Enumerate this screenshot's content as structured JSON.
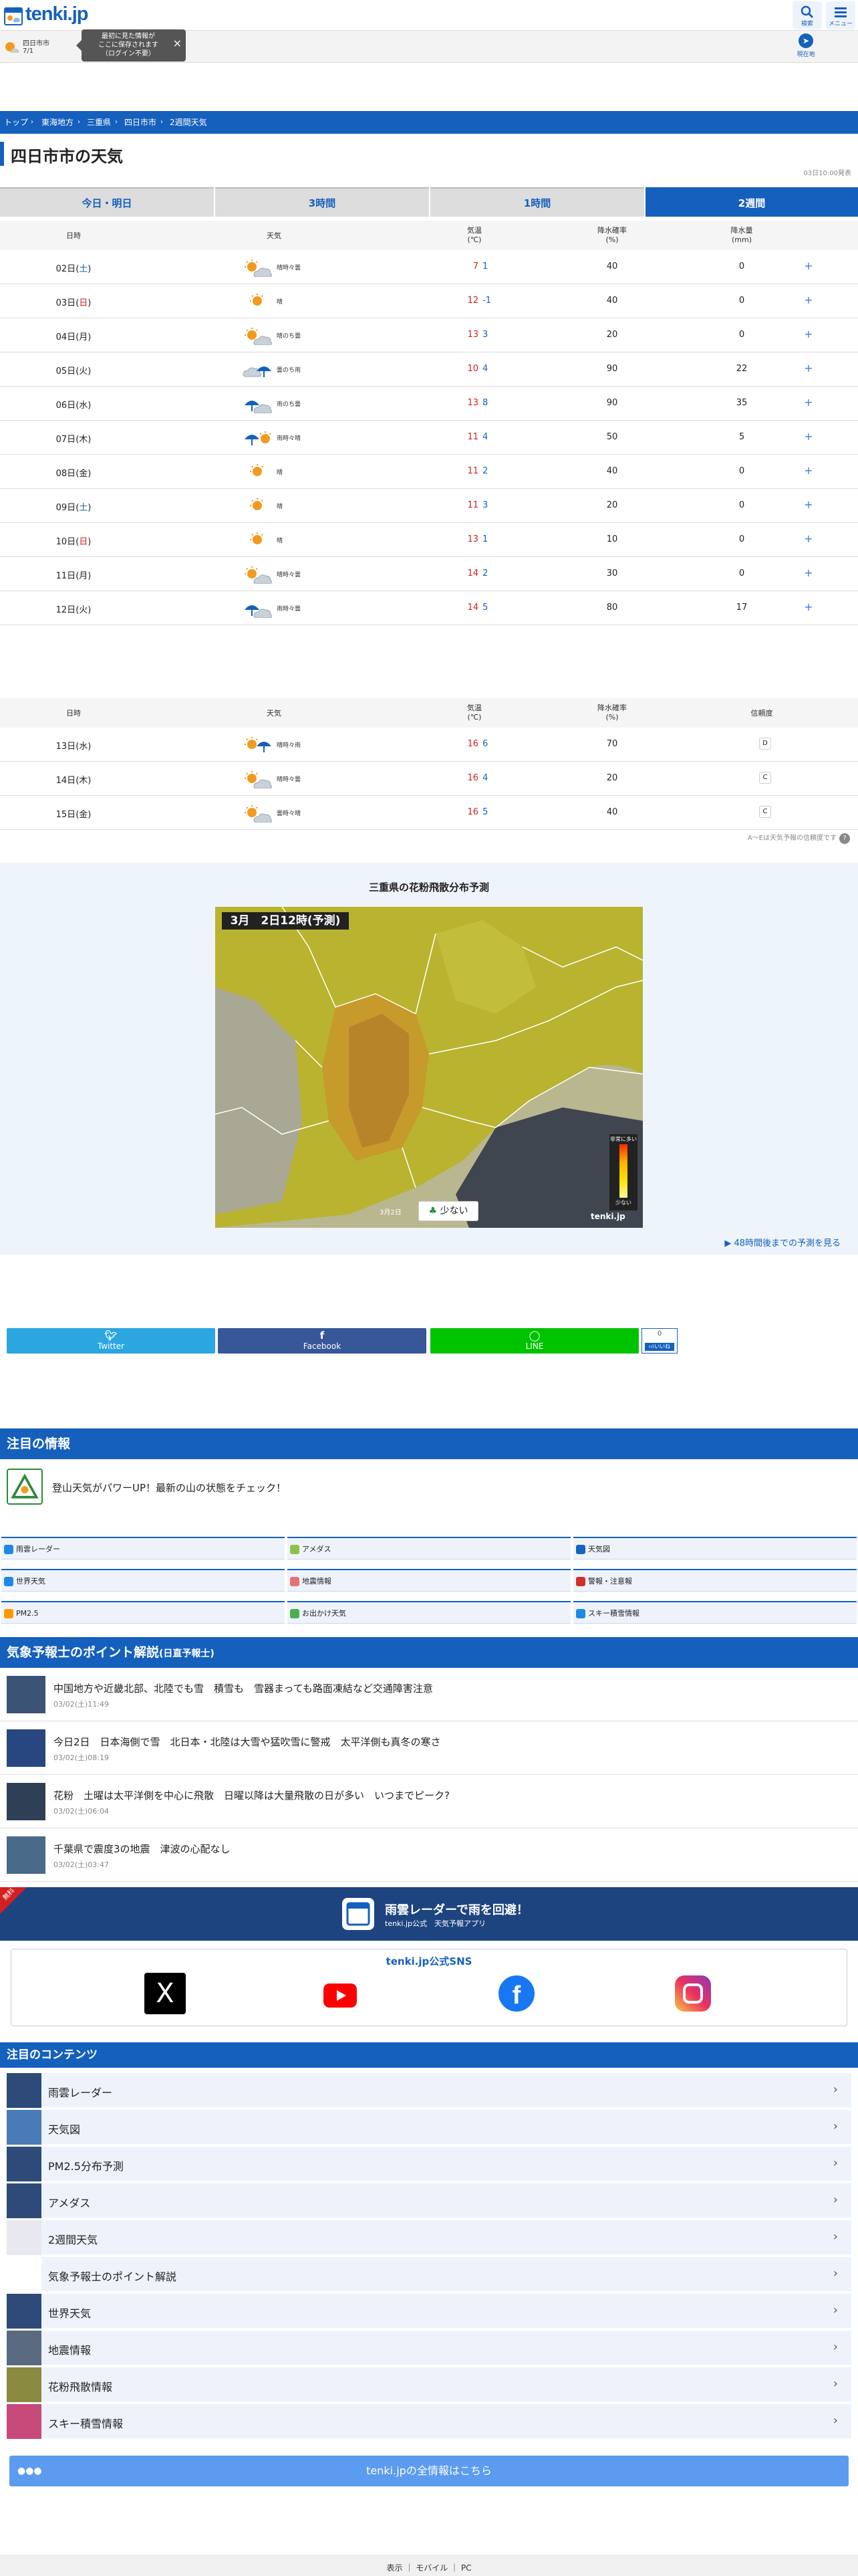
{
  "header": {
    "logo_text": "tenki.jp",
    "search_label": "検索",
    "menu_label": "メニュー"
  },
  "location_bar": {
    "city": "四日市市",
    "temp": "7/1",
    "tooltip": [
      "最初に見た情報が",
      "ここに保存されます",
      "（ログイン不要）"
    ],
    "current_label": "現在地"
  },
  "breadcrumb": [
    "トップ",
    "東海地方",
    "三重県",
    "四日市市",
    "2週間天気"
  ],
  "page_title": "四日市市の天気",
  "issued": "03日10:00発表",
  "tabs": [
    {
      "label": "今日・明日",
      "active": false
    },
    {
      "label": "3時間",
      "active": false
    },
    {
      "label": "1時間",
      "active": false
    },
    {
      "label": "2週間",
      "active": true
    }
  ],
  "table_headers": {
    "date": "日時",
    "weather": "天気",
    "temp": [
      "気温",
      "(℃)"
    ],
    "pop": [
      "降水確率",
      "(%)"
    ],
    "precip": [
      "降水量",
      "(mm)"
    ],
    "reliability": "信頼度"
  },
  "rows1": [
    {
      "date": "02日",
      "dow": "土",
      "weekday_type": "sat",
      "weather": "晴時々曇",
      "icon": "sun-cloud",
      "hi": "7",
      "lo": "1",
      "pop": "40",
      "precip": "0"
    },
    {
      "date": "03日",
      "dow": "日",
      "weekday_type": "sun",
      "weather": "晴",
      "icon": "sun",
      "hi": "12",
      "lo": "-1",
      "pop": "40",
      "precip": "0"
    },
    {
      "date": "04日",
      "dow": "月",
      "weekday_type": "",
      "weather": "晴のち曇",
      "icon": "sun-cloud",
      "hi": "13",
      "lo": "3",
      "pop": "20",
      "precip": "0"
    },
    {
      "date": "05日",
      "dow": "火",
      "weekday_type": "",
      "weather": "曇のち雨",
      "icon": "cloud-rain",
      "hi": "10",
      "lo": "4",
      "pop": "90",
      "precip": "22"
    },
    {
      "date": "06日",
      "dow": "水",
      "weekday_type": "",
      "weather": "雨のち曇",
      "icon": "rain-cloud",
      "hi": "13",
      "lo": "8",
      "pop": "90",
      "precip": "35"
    },
    {
      "date": "07日",
      "dow": "木",
      "weekday_type": "",
      "weather": "雨時々晴",
      "icon": "rain-sun",
      "hi": "11",
      "lo": "4",
      "pop": "50",
      "precip": "5"
    },
    {
      "date": "08日",
      "dow": "金",
      "weekday_type": "",
      "weather": "晴",
      "icon": "sun",
      "hi": "11",
      "lo": "2",
      "pop": "40",
      "precip": "0"
    },
    {
      "date": "09日",
      "dow": "土",
      "weekday_type": "sat",
      "weather": "晴",
      "icon": "sun",
      "hi": "11",
      "lo": "3",
      "pop": "20",
      "precip": "0"
    },
    {
      "date": "10日",
      "dow": "日",
      "weekday_type": "sun",
      "weather": "晴",
      "icon": "sun",
      "hi": "13",
      "lo": "1",
      "pop": "10",
      "precip": "0"
    },
    {
      "date": "11日",
      "dow": "月",
      "weekday_type": "",
      "weather": "晴時々曇",
      "icon": "sun-cloud",
      "hi": "14",
      "lo": "2",
      "pop": "30",
      "precip": "0"
    },
    {
      "date": "12日",
      "dow": "火",
      "weekday_type": "",
      "weather": "雨時々曇",
      "icon": "rain-cloud",
      "hi": "14",
      "lo": "5",
      "pop": "80",
      "precip": "17"
    }
  ],
  "rows2": [
    {
      "date": "13日",
      "dow": "水",
      "weekday_type": "",
      "weather": "晴時々雨",
      "icon": "sun-rain",
      "hi": "16",
      "lo": "6",
      "pop": "70",
      "rel": "D"
    },
    {
      "date": "14日",
      "dow": "木",
      "weekday_type": "",
      "weather": "晴時々曇",
      "icon": "sun-cloud",
      "hi": "16",
      "lo": "4",
      "pop": "20",
      "rel": "C"
    },
    {
      "date": "15日",
      "dow": "金",
      "weekday_type": "",
      "weather": "曇時々晴",
      "icon": "sun-cloud",
      "hi": "16",
      "lo": "5",
      "pop": "40",
      "rel": "C"
    }
  ],
  "conf_note": "A～Eは天気予報の信頼度です",
  "pollen": {
    "title": "三重県の花粉飛散分布予測",
    "map_date": "3月　2日12時(予測)",
    "legend_date": "3月2日",
    "legend_level": "少ない",
    "scale_top": "非常に多い",
    "scale_bottom": "少ない",
    "logo": "tenki.jp",
    "more": "48時間後までの予測を見る"
  },
  "share": {
    "twitter": "Twitter",
    "facebook": "Facebook",
    "line": "LINE",
    "like_count": "0",
    "like_label": "いいね"
  },
  "notice": {
    "heading": "注目の情報",
    "text": "登山天気がパワーUP！最新の山の状態をチェック！"
  },
  "nav_grid": [
    "雨雲レーダー",
    "アメダス",
    "天気図",
    "世界天気",
    "地震情報",
    "警報・注意報",
    "PM2.5",
    "お出かけ天気",
    "スキー積雪情報"
  ],
  "forecaster": {
    "heading": "気象予報士のポイント解説",
    "heading_sub": "(日直予報士)",
    "articles": [
      {
        "title": "中国地方や近畿北部、北陸でも雪　積雪も　雪器まっても路面凍結など交通障害注意",
        "date": "03/02(土)11:49"
      },
      {
        "title": "今日2日　日本海側で雪　北日本・北陸は大雪や猛吹雪に警戒　太平洋側も真冬の寒さ",
        "date": "03/02(土)08:19"
      },
      {
        "title": "花粉　土曜は太平洋側を中心に飛散　日曜以降は大量飛散の日が多い　いつまでピーク?",
        "date": "03/02(土)06:04"
      },
      {
        "title": "千葉県で震度3の地震　津波の心配なし",
        "date": "03/02(土)03:47"
      }
    ]
  },
  "radar_banner": {
    "badge": "無料",
    "title": "雨雲レーダーで雨を回避！",
    "sub": "tenki.jp公式　天気予報アプリ"
  },
  "sns": {
    "title": "tenki.jp公式SNS",
    "x": "X",
    "youtube": "YouTube",
    "facebook": "f",
    "instagram": "Instagram"
  },
  "contents": {
    "heading": "注目のコンテンツ",
    "items": [
      "雨雲レーダー",
      "天気図",
      "PM2.5分布予測",
      "アメダス",
      "2週間天気",
      "気象予報士のポイント解説",
      "世界天気",
      "地震情報",
      "花粉飛散情報",
      "スキー積雪情報"
    ]
  },
  "all_info": "tenki.jpの全情報はこちら",
  "footer": [
    "表示",
    "モバイル",
    "PC"
  ],
  "colors": {
    "brand": "#1560bd",
    "high": "#d42020",
    "low": "#1560bd",
    "twitter": "#2ba6e1",
    "facebook": "#375799",
    "line": "#00c300"
  }
}
